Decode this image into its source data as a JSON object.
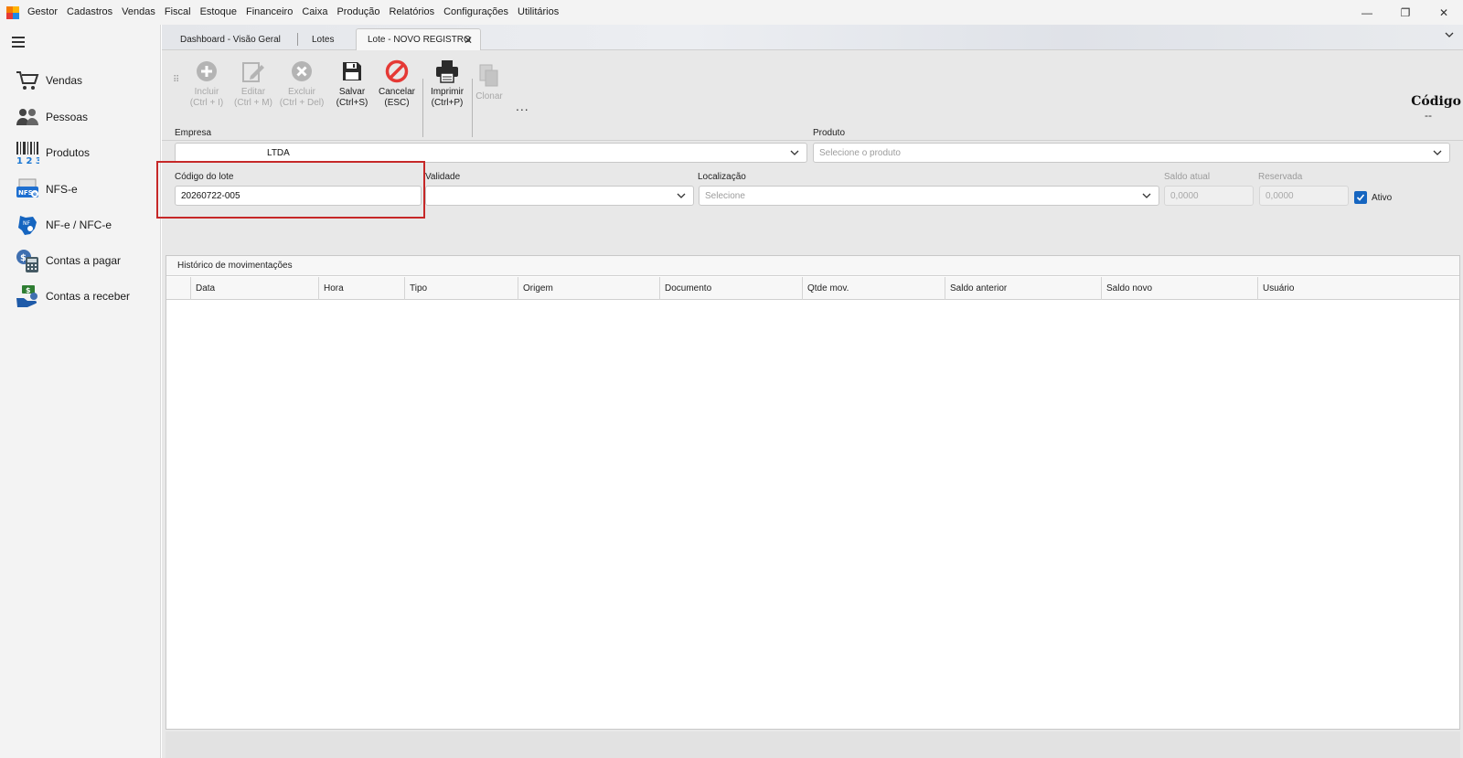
{
  "menubar": {
    "items": [
      "Gestor",
      "Cadastros",
      "Vendas",
      "Fiscal",
      "Estoque",
      "Financeiro",
      "Caixa",
      "Produção",
      "Relatórios",
      "Configurações",
      "Utilitários"
    ]
  },
  "window_controls": {
    "minimize": "—",
    "restore": "❐",
    "close": "✕"
  },
  "sidebar": {
    "items": [
      {
        "label": "Vendas",
        "icon": "cart-icon"
      },
      {
        "label": "Pessoas",
        "icon": "people-icon"
      },
      {
        "label": "Produtos",
        "icon": "barcode-icon"
      },
      {
        "label": "NFS-e",
        "icon": "nfse-icon"
      },
      {
        "label": "NF-e / NFC-e",
        "icon": "nfe-icon"
      },
      {
        "label": "Contas a pagar",
        "icon": "calculator-icon"
      },
      {
        "label": "Contas a receber",
        "icon": "money-hand-icon"
      }
    ]
  },
  "tabs": [
    {
      "label": "Dashboard - Visão Geral"
    },
    {
      "label": "Lotes"
    },
    {
      "label": "Lote - NOVO REGISTRO",
      "close": "✕"
    }
  ],
  "toolbar": {
    "incluir": "Incluir\n(Ctrl + I)",
    "editar": "Editar\n(Ctrl + M)",
    "excluir": "Excluir\n(Ctrl + Del)",
    "salvar": "Salvar\n(Ctrl+S)",
    "cancelar": "Cancelar\n(ESC)",
    "imprimir": "Imprimir\n(Ctrl+P)",
    "clonar": "Clonar",
    "more": "..."
  },
  "header": {
    "codigo_title": "Código",
    "codigo_value": "--"
  },
  "form": {
    "empresa": {
      "label": "Empresa",
      "value": "LTDA"
    },
    "produto": {
      "label": "Produto",
      "placeholder": "Selecione o produto"
    },
    "codigo_lote": {
      "label": "Código do lote",
      "value": "20260722-005"
    },
    "validade": {
      "label": "Validade",
      "value": ""
    },
    "localizacao": {
      "label": "Localização",
      "placeholder": "Selecione"
    },
    "saldo_atual": {
      "label": "Saldo atual",
      "value": "0,0000"
    },
    "reservada": {
      "label": "Reservada",
      "value": "0,0000"
    },
    "ativo": {
      "label": "Ativo",
      "checked": true
    }
  },
  "grid": {
    "title": "Histórico de movimentações",
    "columns": [
      "Data",
      "Hora",
      "Tipo",
      "Origem",
      "Documento",
      "Qtde mov.",
      "Saldo anterior",
      "Saldo novo",
      "Usuário"
    ]
  },
  "colors": {
    "accent": "#1565c0",
    "highlight": "#c62828",
    "cancel": "#e53935"
  }
}
